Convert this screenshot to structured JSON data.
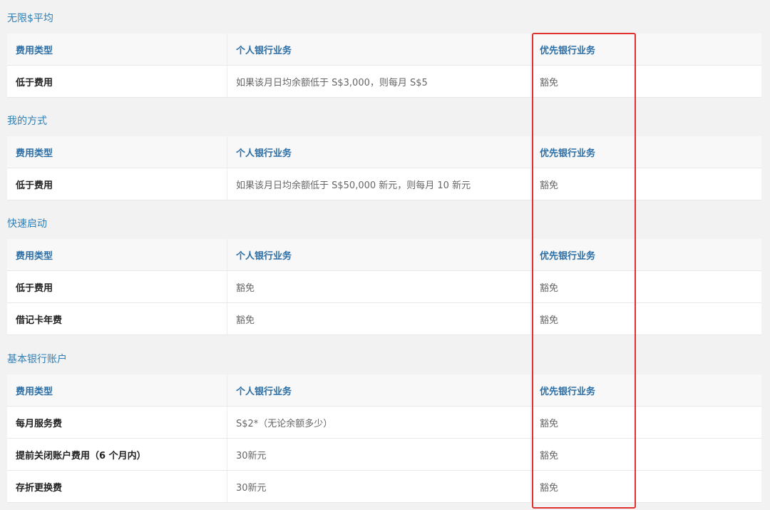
{
  "sections": [
    {
      "title": "无限$平均",
      "headers": [
        "费用类型",
        "个人银行业务",
        "优先银行业务"
      ],
      "rows": [
        [
          "低于费用",
          "如果该月日均余额低于 S$3,000，则每月 S$5",
          "豁免"
        ]
      ]
    },
    {
      "title": "我的方式",
      "headers": [
        "费用类型",
        "个人银行业务",
        "优先银行业务"
      ],
      "rows": [
        [
          "低于费用",
          "如果该月日均余额低于 S$50,000 新元，则每月 10 新元",
          "豁免"
        ]
      ]
    },
    {
      "title": "快速启动",
      "headers": [
        "费用类型",
        "个人银行业务",
        "优先银行业务"
      ],
      "rows": [
        [
          "低于费用",
          "豁免",
          "豁免"
        ],
        [
          "借记卡年费",
          "豁免",
          "豁免"
        ]
      ]
    },
    {
      "title": "基本银行账户",
      "headers": [
        "费用类型",
        "个人银行业务",
        "优先银行业务"
      ],
      "rows": [
        [
          "每月服务费",
          "S$2*（无论余额多少）",
          "豁免"
        ],
        [
          "提前关闭账户费用（6 个月内）",
          "30新元",
          "豁免"
        ],
        [
          "存折更换费",
          "30新元",
          "豁免"
        ]
      ]
    }
  ],
  "highlight": {
    "color": "#e0302f"
  }
}
